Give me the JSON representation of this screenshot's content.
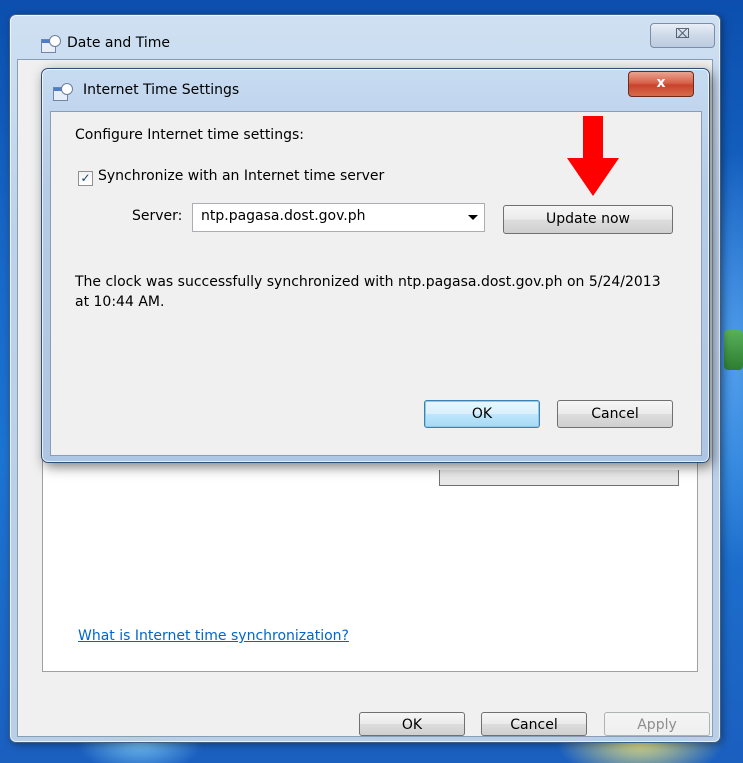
{
  "outer_window": {
    "title": "Date and Time",
    "close_label": "⌧",
    "link": "What is Internet time synchronization?",
    "buttons": {
      "ok": "OK",
      "cancel": "Cancel",
      "apply": "Apply"
    }
  },
  "dialog": {
    "title": "Internet Time Settings",
    "close_label": "x",
    "heading": "Configure Internet time settings:",
    "sync_checkbox": {
      "label": "Synchronize with an Internet time server",
      "checked": true,
      "check_glyph": "✓"
    },
    "server": {
      "label": "Server:",
      "value": "ntp.pagasa.dost.gov.ph"
    },
    "update_button": "Update now",
    "status_message": "The clock was successfully synchronized with ntp.pagasa.dost.gov.ph on 5/24/2013 at 10:44 AM.",
    "ok_button": "OK",
    "cancel_button": "Cancel"
  },
  "annotation": {
    "arrow_color": "#ff0000"
  },
  "icons": {
    "window_icon": "date-time-icon",
    "close": "close-icon",
    "dropdown": "chevron-down-icon",
    "annotation": "red-arrow-icon"
  }
}
